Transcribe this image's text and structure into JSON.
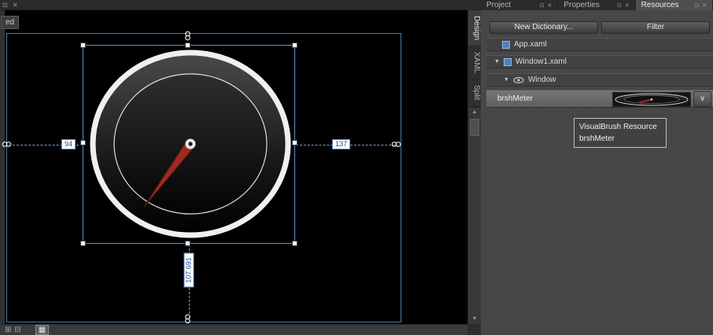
{
  "icons": {
    "pin": "⊡",
    "close": "✕",
    "expander": "▼",
    "chevron_down": "∨",
    "scroll_up": "▲",
    "scroll_down": "▼",
    "grid_a": "⊞",
    "grid_b": "⊟",
    "grid_c": "▦"
  },
  "doc_tab": {
    "label": "ed"
  },
  "adorners": {
    "margin_left": "94",
    "margin_right": "137",
    "margin_bottom": "107.691"
  },
  "view_tabs": {
    "design": "Design",
    "xaml": "XAML",
    "split": "Split"
  },
  "panel_tabs": [
    {
      "label": "Project"
    },
    {
      "label": "Properties"
    },
    {
      "label": "Resources"
    }
  ],
  "resources_panel": {
    "new_dictionary_button": "New Dictionary...",
    "filter_button": "Filter",
    "tree": [
      {
        "label": "App.xaml"
      },
      {
        "label": "Window1.xaml"
      },
      {
        "label": "Window"
      },
      {
        "label": "brshMeter"
      }
    ],
    "tooltip": {
      "line1": "VisualBrush Resource",
      "line2": "brshMeter"
    }
  },
  "colors": {
    "selection_blue": "#5d93d6",
    "artboard_border_blue": "#4a77b4",
    "needle_red": "#9e2b22",
    "dial_ring_white": "#f0f0f0",
    "panel_background": "#474747"
  }
}
